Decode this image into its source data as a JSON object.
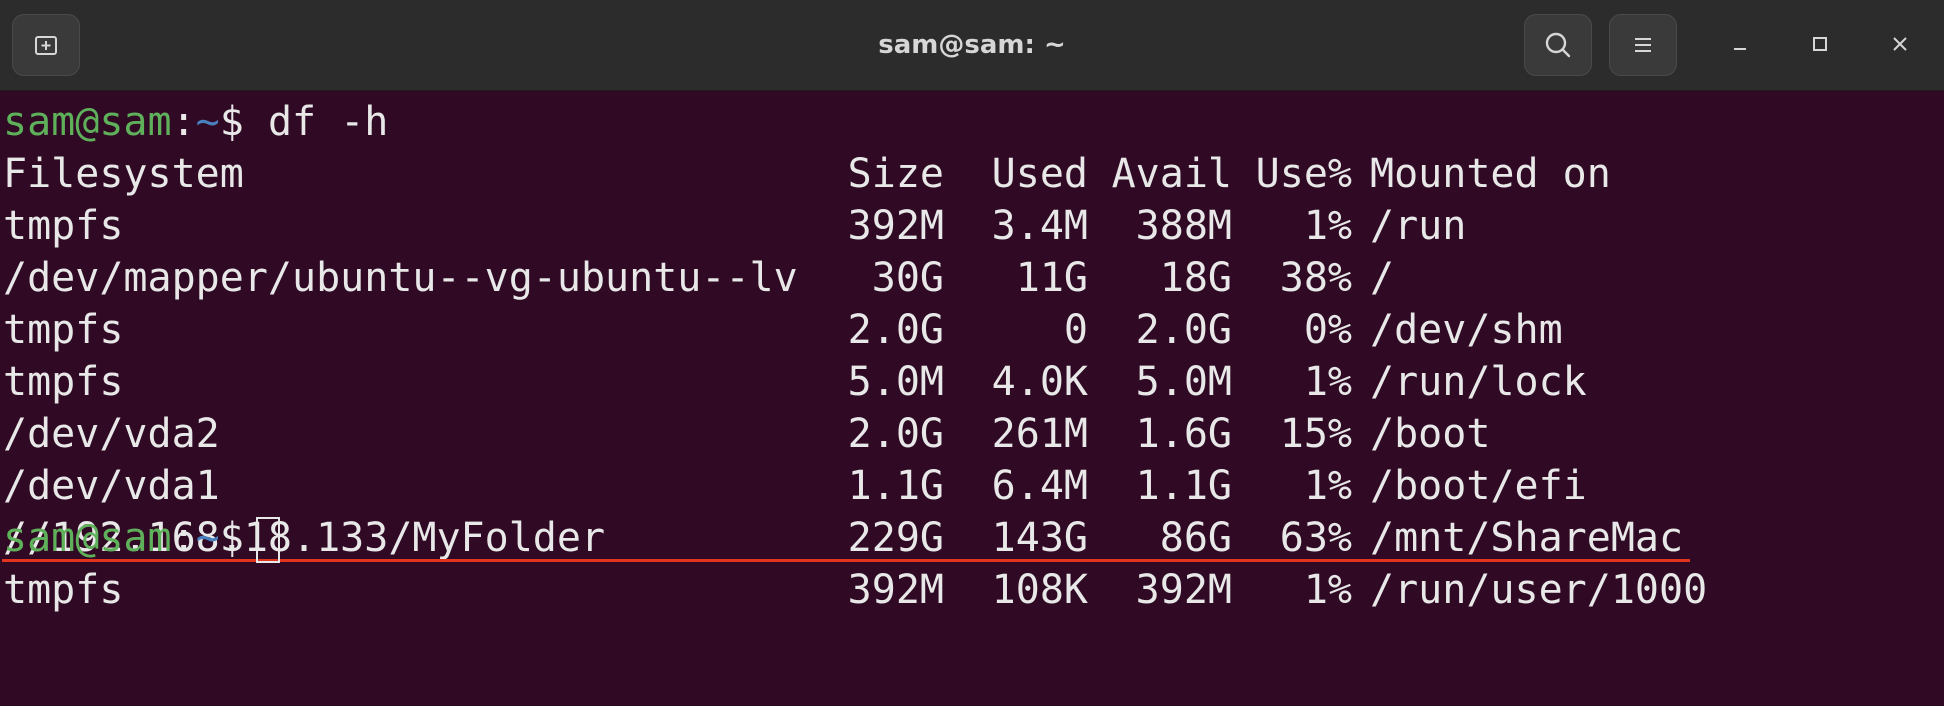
{
  "window": {
    "title": "sam@sam: ~"
  },
  "prompt": {
    "user_host": "sam@sam",
    "colon": ":",
    "path": "~",
    "symbol": "$"
  },
  "commands": [
    {
      "text": "df -h"
    }
  ],
  "df": {
    "headers": [
      "Filesystem",
      "Size",
      "Used",
      "Avail",
      "Use%",
      "Mounted on"
    ],
    "rows": [
      [
        "tmpfs",
        "392M",
        "3.4M",
        "388M",
        "1%",
        "/run"
      ],
      [
        "/dev/mapper/ubuntu--vg-ubuntu--lv",
        "30G",
        "11G",
        "18G",
        "38%",
        "/"
      ],
      [
        "tmpfs",
        "2.0G",
        "0",
        "2.0G",
        "0%",
        "/dev/shm"
      ],
      [
        "tmpfs",
        "5.0M",
        "4.0K",
        "5.0M",
        "1%",
        "/run/lock"
      ],
      [
        "/dev/vda2",
        "2.0G",
        "261M",
        "1.6G",
        "15%",
        "/boot"
      ],
      [
        "/dev/vda1",
        "1.1G",
        "6.4M",
        "1.1G",
        "1%",
        "/boot/efi"
      ],
      [
        "//192.168.18.133/MyFolder",
        "229G",
        "143G",
        "86G",
        "63%",
        "/mnt/ShareMac"
      ],
      [
        "tmpfs",
        "392M",
        "108K",
        "392M",
        "1%",
        "/run/user/1000"
      ]
    ]
  },
  "icons": {
    "new_tab": "new-tab-icon",
    "search": "search-icon",
    "menu": "hamburger-menu-icon",
    "minimize": "minimize-icon",
    "maximize": "maximize-icon",
    "close": "close-icon"
  },
  "colors": {
    "terminal_bg": "#300a24",
    "titlebar_bg": "#2c2c2c",
    "prompt_user": "#5fb05a",
    "prompt_path": "#4a7fbd",
    "text": "#e8e8e8",
    "highlight_underline": "#e0341e"
  }
}
